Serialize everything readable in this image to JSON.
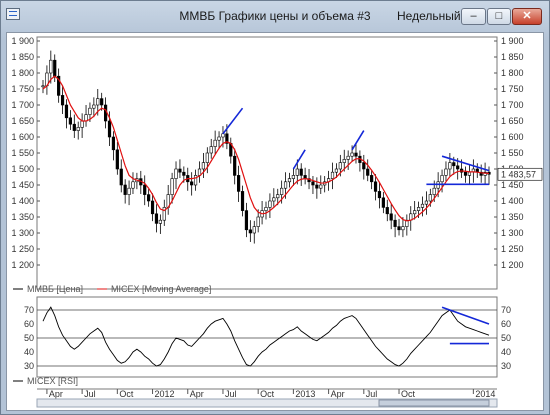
{
  "window": {
    "title": "ММВБ Графики цены и объема #3",
    "period": "Недельный",
    "buttons": {
      "minimize": "–",
      "maximize": "□",
      "close": "✕"
    }
  },
  "price_panel": {
    "y_ticks": [
      "1 900",
      "1 850",
      "1 800",
      "1 750",
      "1 700",
      "1 650",
      "1 600",
      "1 550",
      "1 500",
      "1 450",
      "1 400",
      "1 350",
      "1 300",
      "1 250",
      "1 200"
    ],
    "last_price_label": "1 483,57",
    "legend": [
      {
        "label": "ММВБ [Цена]",
        "color": "#000000"
      },
      {
        "label": "MICEX [Moving Average]",
        "color": "#e01010"
      }
    ]
  },
  "rsi_panel": {
    "y_ticks": [
      "70",
      "60",
      "50",
      "40",
      "30"
    ],
    "legend": [
      {
        "label": "MICEX [RSI]",
        "color": "#000000"
      }
    ]
  },
  "x_axis": {
    "labels": [
      "Apr",
      "Jul",
      "Oct",
      "2012",
      "Apr",
      "Jul",
      "Oct",
      "2013",
      "Apr",
      "Jul",
      "Oct",
      "2014"
    ]
  },
  "colors": {
    "price": "#000000",
    "ma": "#e01010",
    "annotation": "#1428d8",
    "rsi": "#000000"
  },
  "chart_data": [
    {
      "type": "line",
      "series": [
        {
          "name": "ММВБ [Цена]",
          "values": [
            1760,
            1800,
            1840,
            1790,
            1730,
            1700,
            1660,
            1640,
            1620,
            1630,
            1650,
            1670,
            1690,
            1700,
            1720,
            1700,
            1650,
            1600,
            1560,
            1500,
            1450,
            1420,
            1440,
            1460,
            1470,
            1450,
            1420,
            1400,
            1360,
            1330,
            1340,
            1380,
            1420,
            1470,
            1500,
            1490,
            1480,
            1460,
            1450,
            1480,
            1500,
            1520,
            1550,
            1570,
            1590,
            1600,
            1610,
            1580,
            1540,
            1480,
            1430,
            1370,
            1310,
            1300,
            1320,
            1350,
            1370,
            1380,
            1400,
            1410,
            1420,
            1440,
            1460,
            1470,
            1480,
            1500,
            1480,
            1470,
            1460,
            1450,
            1440,
            1450,
            1460,
            1470,
            1490,
            1500,
            1520,
            1530,
            1540,
            1550,
            1540,
            1520,
            1500,
            1480,
            1460,
            1430,
            1410,
            1380,
            1360,
            1340,
            1320,
            1310,
            1320,
            1340,
            1360,
            1370,
            1380,
            1390,
            1400,
            1420,
            1440,
            1460,
            1480,
            1500,
            1520,
            1510,
            1500,
            1490,
            1480,
            1490,
            1500,
            1490,
            1480,
            1490,
            1483.57
          ]
        },
        {
          "name": "MICEX [Moving Average]",
          "values": [
            1750,
            1760,
            1780,
            1790,
            1780,
            1760,
            1730,
            1700,
            1680,
            1660,
            1650,
            1650,
            1655,
            1665,
            1680,
            1690,
            1685,
            1660,
            1630,
            1590,
            1550,
            1510,
            1480,
            1470,
            1465,
            1462,
            1455,
            1440,
            1420,
            1395,
            1375,
            1370,
            1380,
            1400,
            1425,
            1450,
            1465,
            1470,
            1470,
            1472,
            1478,
            1490,
            1505,
            1525,
            1545,
            1565,
            1580,
            1585,
            1580,
            1560,
            1530,
            1490,
            1450,
            1410,
            1380,
            1365,
            1360,
            1362,
            1370,
            1380,
            1392,
            1405,
            1420,
            1435,
            1450,
            1462,
            1468,
            1470,
            1468,
            1464,
            1460,
            1456,
            1456,
            1460,
            1466,
            1475,
            1488,
            1500,
            1512,
            1524,
            1532,
            1532,
            1525,
            1512,
            1496,
            1478,
            1458,
            1436,
            1414,
            1392,
            1372,
            1354,
            1342,
            1338,
            1340,
            1346,
            1356,
            1366,
            1378,
            1392,
            1408,
            1425,
            1442,
            1460,
            1476,
            1486,
            1492,
            1494,
            1493,
            1491,
            1491,
            1490,
            1488,
            1487,
            1486
          ]
        }
      ],
      "ylim": [
        1150,
        1900
      ]
    },
    {
      "type": "line",
      "series": [
        {
          "name": "MICEX [RSI]",
          "values": [
            62,
            68,
            72,
            66,
            58,
            52,
            48,
            44,
            42,
            44,
            47,
            50,
            53,
            55,
            57,
            54,
            47,
            42,
            38,
            34,
            32,
            33,
            36,
            40,
            42,
            40,
            37,
            35,
            32,
            30,
            31,
            35,
            40,
            46,
            50,
            49,
            48,
            45,
            44,
            47,
            50,
            53,
            57,
            60,
            62,
            63,
            64,
            60,
            55,
            48,
            42,
            36,
            31,
            30,
            33,
            37,
            40,
            42,
            45,
            47,
            49,
            51,
            53,
            55,
            56,
            58,
            55,
            53,
            51,
            49,
            48,
            50,
            52,
            54,
            57,
            59,
            62,
            64,
            65,
            66,
            64,
            60,
            56,
            52,
            48,
            44,
            41,
            38,
            35,
            33,
            31,
            30,
            32,
            35,
            39,
            42,
            45,
            48,
            51,
            54,
            58,
            62,
            66,
            68,
            70,
            66,
            62,
            60,
            58,
            57,
            56,
            55,
            54,
            53,
            52
          ]
        }
      ],
      "ylim": [
        25,
        75
      ]
    }
  ]
}
